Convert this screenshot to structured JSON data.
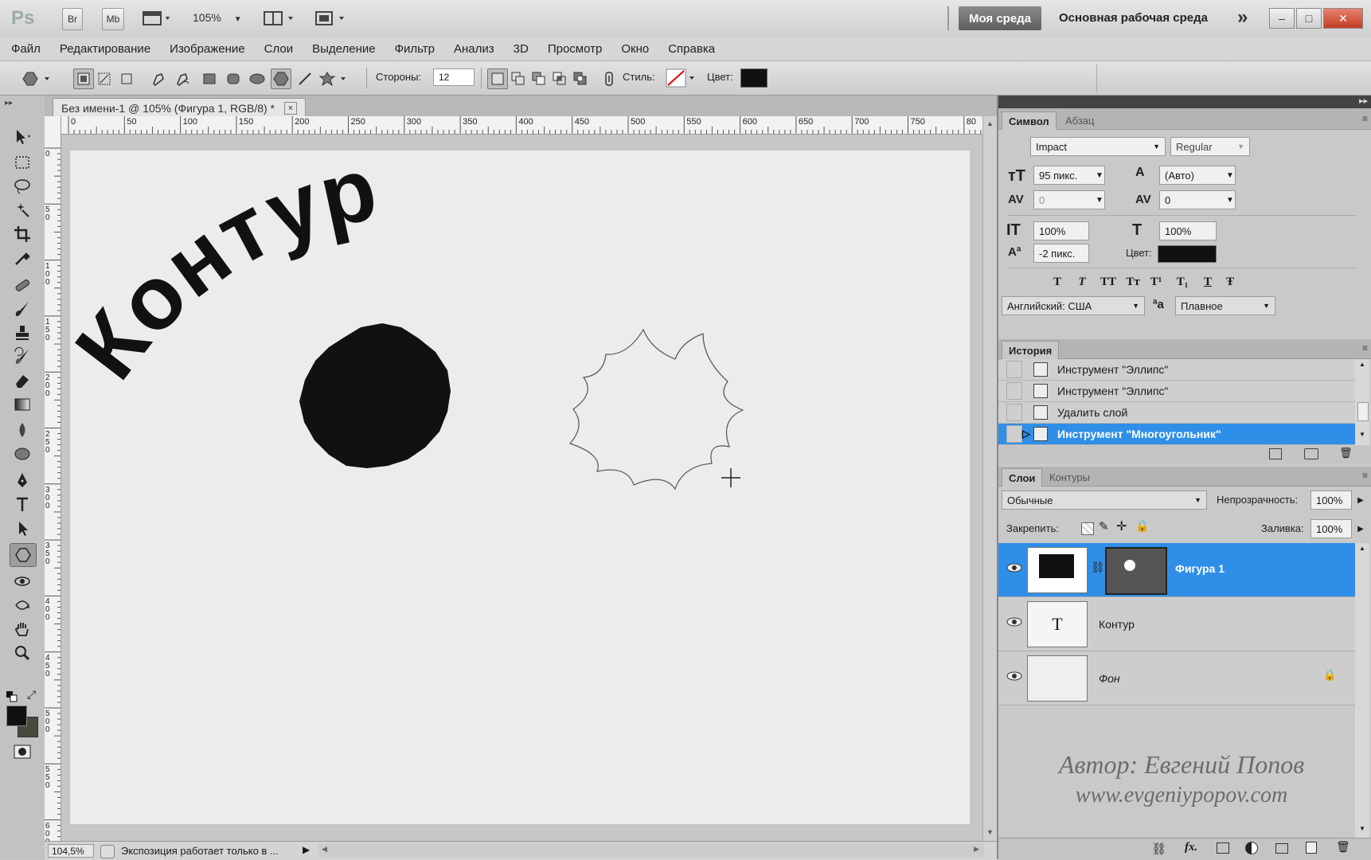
{
  "titlebar": {
    "logo": "Ps",
    "br": "Br",
    "mb": "Mb",
    "zoom": "105%",
    "workspace_active": "Моя среда",
    "workspace_main": "Основная рабочая среда",
    "more": "»",
    "minimize": "–",
    "maximize": "□",
    "close": "✕"
  },
  "menu": [
    "Файл",
    "Редактирование",
    "Изображение",
    "Слои",
    "Выделение",
    "Фильтр",
    "Анализ",
    "3D",
    "Просмотр",
    "Окно",
    "Справка"
  ],
  "options": {
    "sides_label": "Стороны:",
    "sides_value": "12",
    "style_label": "Стиль:",
    "color_label": "Цвет:",
    "color_value": "#111111"
  },
  "document": {
    "tab_title": "Без имени-1 @ 105% (Фигура 1, RGB/8) *",
    "tab_close": "×",
    "ruler_h": [
      "0",
      "50",
      "100",
      "150",
      "200",
      "250",
      "300",
      "350",
      "400",
      "450",
      "500",
      "550",
      "600",
      "650",
      "700",
      "750",
      "80"
    ],
    "ruler_v": [
      "0",
      "5\n0",
      "1\n0\n0",
      "1\n5\n0",
      "2\n0\n0",
      "2\n5\n0",
      "3\n0\n0",
      "3\n5\n0",
      "4\n0\n0",
      "4\n5\n0",
      "5\n0\n0",
      "5\n5\n0",
      "6\n0\n0"
    ],
    "canvas_text": "Контур",
    "zoom_status": "104,5%",
    "status_text": "Экспозиция работает только в ..."
  },
  "character_panel": {
    "tabs": [
      "Символ",
      "Абзац"
    ],
    "font_family": "Impact",
    "font_style": "Regular",
    "font_size": "95 пикс.",
    "leading": "(Авто)",
    "kerning": "0",
    "tracking": "0",
    "vscale": "100%",
    "hscale": "100%",
    "baseline": "-2 пикс.",
    "color_label": "Цвет:",
    "color_value": "#111111",
    "language": "Английский: США",
    "aa_icon": "ªa",
    "antialias": "Плавное",
    "type_buttons": [
      "T",
      "T",
      "TT",
      "Tт",
      "T¹",
      "T₁",
      "T",
      "Ŧ"
    ]
  },
  "history_panel": {
    "title": "История",
    "items": [
      {
        "label": "Инструмент \"Эллипс\"",
        "selected": false
      },
      {
        "label": "Инструмент \"Эллипс\"",
        "selected": false
      },
      {
        "label": "Удалить слой",
        "selected": false
      },
      {
        "label": "Инструмент \"Многоугольник\"",
        "selected": true
      }
    ]
  },
  "layers_panel": {
    "tabs": [
      "Слои",
      "Контуры"
    ],
    "blend_mode": "Обычные",
    "opacity_label": "Непрозрачность:",
    "opacity_value": "100%",
    "lock_label": "Закрепить:",
    "fill_label": "Заливка:",
    "fill_value": "100%",
    "layers": [
      {
        "name": "Фигура 1",
        "selected": true
      },
      {
        "name": "Контур",
        "selected": false
      },
      {
        "name": "Фон",
        "selected": false
      }
    ],
    "text_thumb": "T"
  },
  "watermark": {
    "line1": "Автор: Евгений Попов",
    "line2": "www.evgeniypopov.com"
  }
}
